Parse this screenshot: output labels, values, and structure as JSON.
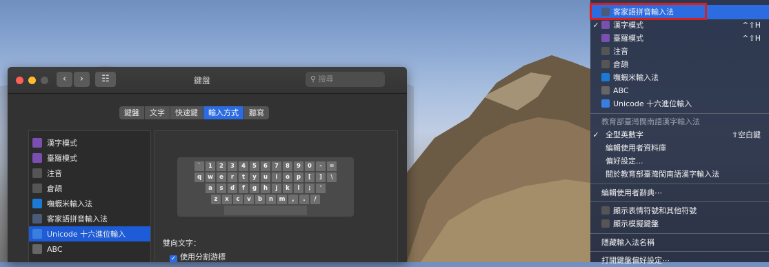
{
  "window": {
    "title": "鍵盤",
    "search_placeholder": "搜尋",
    "grid_icon_label": "☷",
    "nav_back": "‹",
    "nav_forward": "›",
    "tabs": [
      {
        "label": "鍵盤",
        "selected": false
      },
      {
        "label": "文字",
        "selected": false
      },
      {
        "label": "快速鍵",
        "selected": false
      },
      {
        "label": "輸入方式",
        "selected": true
      },
      {
        "label": "聽寫",
        "selected": false
      }
    ],
    "sources": [
      {
        "label": "漢字模式",
        "icon": "han-icon",
        "color": "#7a4fb0"
      },
      {
        "label": "臺羅模式",
        "icon": "tailo-icon",
        "color": "#7a4fb0"
      },
      {
        "label": "注音",
        "icon": "zhuyin-icon",
        "color": "#555555"
      },
      {
        "label": "倉頡",
        "icon": "cangjie-icon",
        "color": "#555555"
      },
      {
        "label": "嘸蝦米輸入法",
        "icon": "boshiamy-icon",
        "color": "#1c7ad6"
      },
      {
        "label": "客家語拼音輸入法",
        "icon": "hakka-icon",
        "color": "#4a5a78"
      },
      {
        "label": "Unicode 十六進位輸入",
        "icon": "unicode-icon",
        "color": "#3a7ee0",
        "selected": true
      },
      {
        "label": "ABC",
        "icon": "abc-icon",
        "color": "#666666"
      }
    ],
    "keyboard_rows": [
      [
        "`",
        "1",
        "2",
        "3",
        "4",
        "5",
        "6",
        "7",
        "8",
        "9",
        "0",
        "-",
        "="
      ],
      [
        "q",
        "w",
        "e",
        "r",
        "t",
        "y",
        "u",
        "i",
        "o",
        "p",
        "[",
        "]",
        "\\"
      ],
      [
        "a",
        "s",
        "d",
        "f",
        "g",
        "h",
        "j",
        "k",
        "l",
        ";",
        "'"
      ],
      [
        "z",
        "x",
        "c",
        "v",
        "b",
        "n",
        "m",
        ",",
        ".",
        "/"
      ]
    ],
    "bidi_label": "雙向文字：",
    "split_cursor_label": "使用分割游標"
  },
  "menu": {
    "items": [
      {
        "label": "客家語拼音輸入法",
        "shortcut": "",
        "highlighted": true,
        "check": ""
      },
      {
        "label": "漢字模式",
        "shortcut": "^⇧H",
        "check": "✓"
      },
      {
        "label": "臺羅模式",
        "shortcut": "^⇧H",
        "check": ""
      },
      {
        "label": "注音",
        "shortcut": "",
        "check": ""
      },
      {
        "label": "倉頡",
        "shortcut": "",
        "check": ""
      },
      {
        "label": "嘸蝦米輸入法",
        "shortcut": "",
        "check": ""
      },
      {
        "label": "ABC",
        "shortcut": "",
        "check": ""
      },
      {
        "label": "Unicode 十六進位輸入",
        "shortcut": "",
        "check": ""
      }
    ],
    "section_header": "教育部臺灣閩南語漢字輸入法",
    "sub_items": [
      {
        "label": "全型英數字",
        "shortcut": "⇧空白鍵",
        "check": "✓"
      },
      {
        "label": "編輯使用者資料庫",
        "shortcut": "",
        "check": ""
      },
      {
        "label": "偏好設定...",
        "shortcut": "",
        "check": ""
      },
      {
        "label": "關於教育部臺灣閩南語漢字輸入法",
        "shortcut": "",
        "check": ""
      }
    ],
    "edit_dictionary": "編輯使用者辭典⋯",
    "show_emoji": "顯示表情符號和其他符號",
    "show_keyboard_viewer": "顯示模擬鍵盤",
    "hide_name": "隱藏輸入法名稱",
    "open_prefs": "打開鍵盤偏好設定⋯"
  },
  "colors": {
    "accent": "#2d6ce0",
    "annotation": "#d62020"
  }
}
